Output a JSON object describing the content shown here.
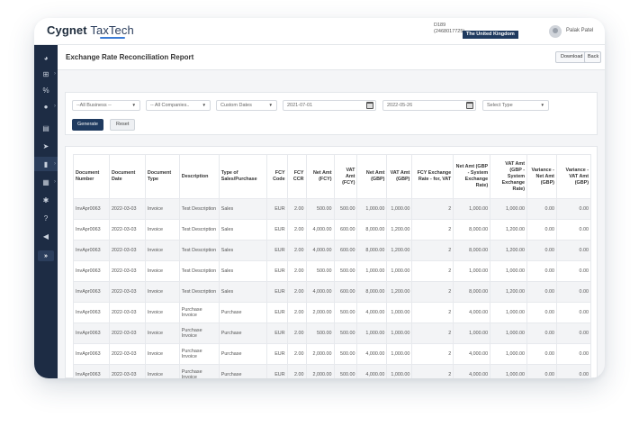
{
  "app": {
    "brand_main": "Cygnet",
    "brand_sub": "TaxTech"
  },
  "entity": {
    "line1": "D189",
    "line2": "(2468017725)",
    "country": "The United Kingdom"
  },
  "user": {
    "name": "Palak Patel"
  },
  "sidebar": {
    "items": [
      {
        "icon": "dashboard-icon",
        "glyph": "◕",
        "chevron": ""
      },
      {
        "icon": "hierarchy-icon",
        "glyph": "⊞",
        "chevron": "›"
      },
      {
        "icon": "percent-icon",
        "glyph": "%",
        "chevron": ""
      },
      {
        "icon": "user-icon",
        "glyph": "●",
        "chevron": "›"
      },
      {
        "icon": "document-icon",
        "glyph": "▤",
        "chevron": ""
      },
      {
        "icon": "send-icon",
        "glyph": "➤",
        "chevron": ""
      },
      {
        "icon": "report-icon",
        "glyph": "▮",
        "chevron": "›"
      },
      {
        "icon": "file-icon",
        "glyph": "▦",
        "chevron": "›"
      },
      {
        "icon": "gear-icon",
        "glyph": "✱",
        "chevron": ""
      },
      {
        "icon": "help-icon",
        "glyph": "?",
        "chevron": ""
      },
      {
        "icon": "megaphone-icon",
        "glyph": "◀",
        "chevron": ""
      }
    ],
    "expand": "»"
  },
  "page": {
    "title": "Exchange Rate Reconciliation Report",
    "download": "Download ▾",
    "back": "Back"
  },
  "filters": {
    "business": "--All Business --",
    "companies": "-- All Companies..",
    "date_range": "Custom Dates",
    "from_date": "2021-07-01",
    "to_date": "2022-05-26",
    "type_placeholder": "Select Type",
    "generate": "Generate",
    "reset": "Reset"
  },
  "table": {
    "headers": [
      "Document Number",
      "Document Date",
      "Document Type",
      "Description",
      "Type of Sales/Purchase",
      "FCY Code",
      "FCY CCR",
      "Net Amt (FCY)",
      "VAT Amt (FCY)",
      "Net Amt (GBP)",
      "VAT Amt (GBP)",
      "FCY Exchange Rate - for, VAT",
      "Net Amt (GBP - System Exchange Rate)",
      "VAT Amt (GBP - System Exchange Rate)",
      "Variance - Net Amt (GBP)",
      "Variance - VAT Amt (GBP)"
    ],
    "rows": [
      [
        "InvApr0063",
        "2022-03-03",
        "Invoice",
        "Test Description",
        "Sales",
        "EUR",
        "2.00",
        "500.00",
        "500.00",
        "1,000.00",
        "1,000.00",
        "2",
        "1,000.00",
        "1,000.00",
        "0.00",
        "0.00"
      ],
      [
        "InvApr0063",
        "2022-03-03",
        "Invoice",
        "Test Description",
        "Sales",
        "EUR",
        "2.00",
        "4,000.00",
        "600.00",
        "8,000.00",
        "1,200.00",
        "2",
        "8,000.00",
        "1,200.00",
        "0.00",
        "0.00"
      ],
      [
        "InvApr0063",
        "2022-03-03",
        "Invoice",
        "Test Description",
        "Sales",
        "EUR",
        "2.00",
        "4,000.00",
        "600.00",
        "8,000.00",
        "1,200.00",
        "2",
        "8,000.00",
        "1,200.00",
        "0.00",
        "0.00"
      ],
      [
        "InvApr0063",
        "2022-03-03",
        "Invoice",
        "Test Description",
        "Sales",
        "EUR",
        "2.00",
        "500.00",
        "500.00",
        "1,000.00",
        "1,000.00",
        "2",
        "1,000.00",
        "1,000.00",
        "0.00",
        "0.00"
      ],
      [
        "InvApr0063",
        "2022-03-03",
        "Invoice",
        "Test Description",
        "Sales",
        "EUR",
        "2.00",
        "4,000.00",
        "600.00",
        "8,000.00",
        "1,200.00",
        "2",
        "8,000.00",
        "1,200.00",
        "0.00",
        "0.00"
      ],
      [
        "InvApr0063",
        "2022-03-03",
        "Invoice",
        "Purchase Invoice",
        "Purchase",
        "EUR",
        "2.00",
        "2,000.00",
        "500.00",
        "4,000.00",
        "1,000.00",
        "2",
        "4,000.00",
        "1,000.00",
        "0.00",
        "0.00"
      ],
      [
        "InvApr0063",
        "2022-03-03",
        "Invoice",
        "Purchase Invoice",
        "Purchase",
        "EUR",
        "2.00",
        "500.00",
        "500.00",
        "1,000.00",
        "1,000.00",
        "2",
        "1,000.00",
        "1,000.00",
        "0.00",
        "0.00"
      ],
      [
        "InvApr0063",
        "2022-03-03",
        "Invoice",
        "Purchase Invoice",
        "Purchase",
        "EUR",
        "2.00",
        "2,000.00",
        "500.00",
        "4,000.00",
        "1,000.00",
        "2",
        "4,000.00",
        "1,000.00",
        "0.00",
        "0.00"
      ],
      [
        "InvApr0063",
        "2022-03-03",
        "Invoice",
        "Purchase Invoice",
        "Purchase",
        "EUR",
        "2.00",
        "2,000.00",
        "500.00",
        "4,000.00",
        "1,000.00",
        "2",
        "4,000.00",
        "1,000.00",
        "0.00",
        "0.00"
      ]
    ]
  },
  "colors": {
    "sidebar": "#1d2c44",
    "primary": "#1f3a5f",
    "accent": "#3a7bd5"
  }
}
